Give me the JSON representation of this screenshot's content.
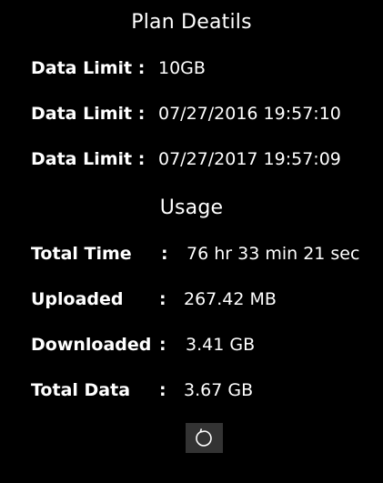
{
  "plan": {
    "title": "Plan Deatils",
    "rows": [
      {
        "label": "Data Limit :",
        "value": "10GB"
      },
      {
        "label": "Data Limit :",
        "value": "07/27/2016 19:57:10"
      },
      {
        "label": "Data Limit :",
        "value": "07/27/2017 19:57:09"
      }
    ]
  },
  "usage": {
    "title": "Usage",
    "colon": ":",
    "rows": [
      {
        "label": "Total Time",
        "value": "76 hr 33 min 21 sec"
      },
      {
        "label": "Uploaded",
        "value": "267.42 MB"
      },
      {
        "label": "Downloaded",
        "value": "3.41 GB"
      },
      {
        "label": "Total Data",
        "value": "3.67 GB"
      }
    ]
  },
  "actions": {
    "refresh_icon": "refresh-icon"
  },
  "colors": {
    "background": "#000000",
    "text": "#ffffff",
    "button_bg": "#333333"
  }
}
